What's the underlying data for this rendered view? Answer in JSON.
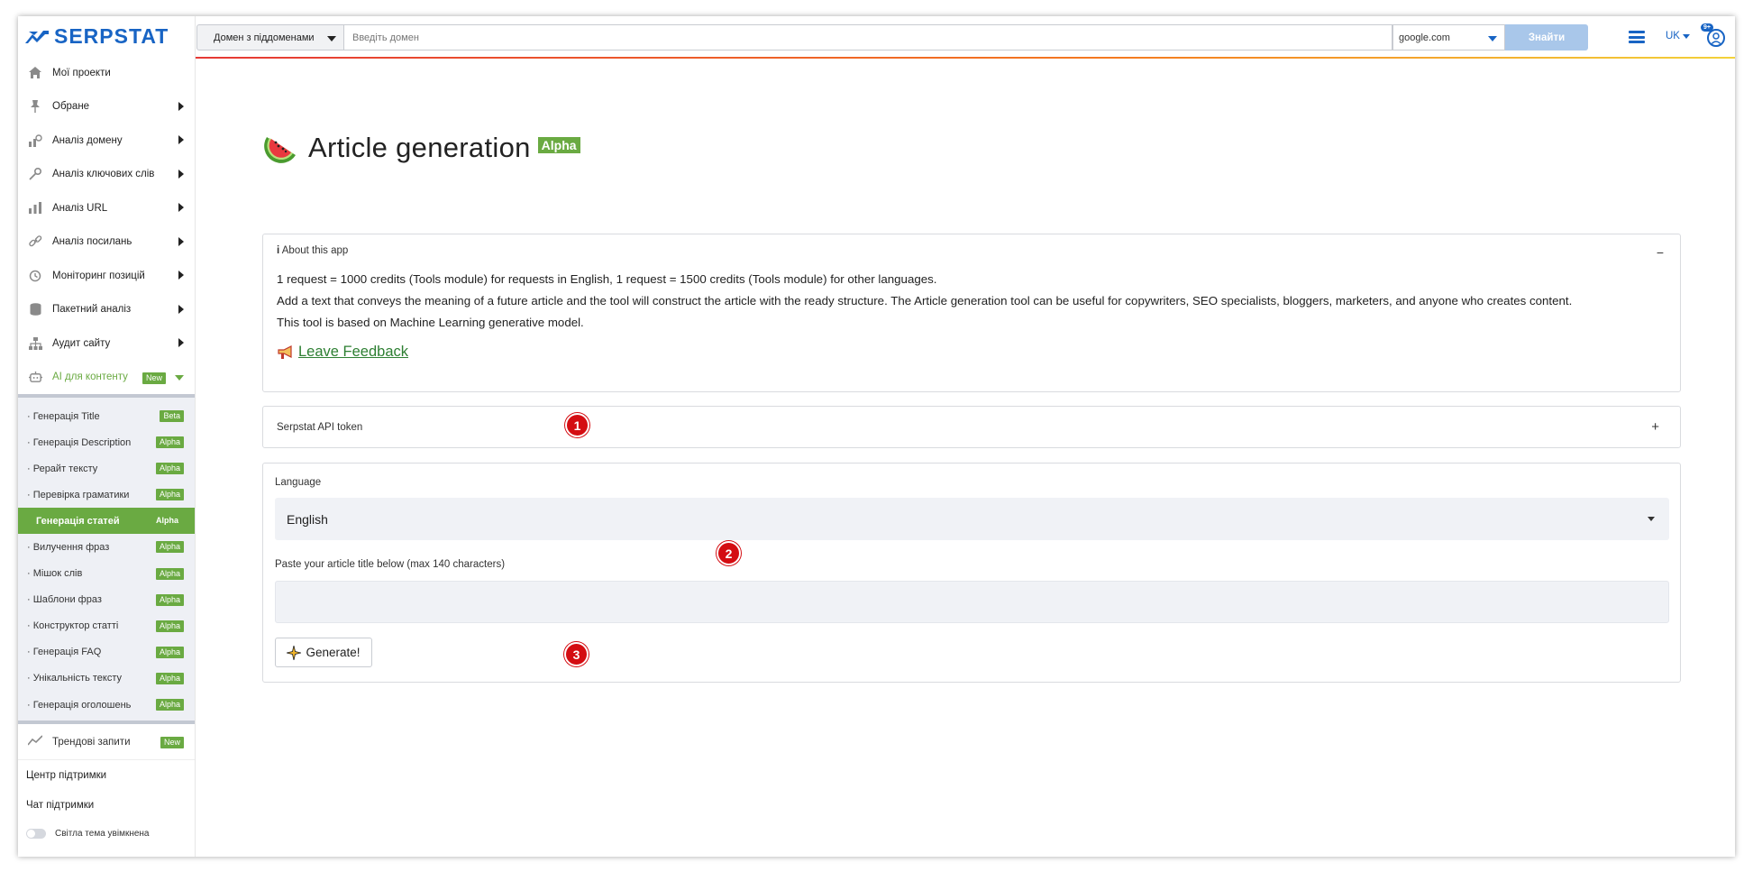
{
  "brand": {
    "name": "SERPSTAT",
    "color": "#1864c4",
    "accent_green": "#6aaa42"
  },
  "sidebar": {
    "items": [
      {
        "label": "Мої проекти",
        "icon": "home-icon",
        "has_arrow": false
      },
      {
        "label": "Обране",
        "icon": "pin-icon",
        "has_arrow": true
      },
      {
        "label": "Аналіз домену",
        "icon": "domain-analysis-icon",
        "has_arrow": true
      },
      {
        "label": "Аналіз ключових слів",
        "icon": "key-icon",
        "has_arrow": true
      },
      {
        "label": "Аналіз URL",
        "icon": "bar-chart-icon",
        "has_arrow": true
      },
      {
        "label": "Аналіз посилань",
        "icon": "link-icon",
        "has_arrow": true
      },
      {
        "label": "Моніторинг позицій",
        "icon": "history-icon",
        "has_arrow": true
      },
      {
        "label": "Пакетний аналіз",
        "icon": "database-icon",
        "has_arrow": true
      },
      {
        "label": "Аудит сайту",
        "icon": "sitemap-icon",
        "has_arrow": true
      }
    ],
    "ai": {
      "label": "AI для контенту",
      "badge": "New",
      "icon": "robot-icon"
    },
    "submenu": [
      {
        "label": "· Генерація Title",
        "badge": "Beta",
        "active": false
      },
      {
        "label": "· Генерація Description",
        "badge": "Alpha",
        "active": false
      },
      {
        "label": "· Рерайт тексту",
        "badge": "Alpha",
        "active": false
      },
      {
        "label": "· Перевірка граматики",
        "badge": "Alpha",
        "active": false
      },
      {
        "label": "Генерація статей",
        "badge": "Alpha",
        "active": true
      },
      {
        "label": "· Вилучення фраз",
        "badge": "Alpha",
        "active": false
      },
      {
        "label": "· Мішок слів",
        "badge": "Alpha",
        "active": false
      },
      {
        "label": "· Шаблони фраз",
        "badge": "Alpha",
        "active": false
      },
      {
        "label": "· Конструктор статті",
        "badge": "Alpha",
        "active": false
      },
      {
        "label": "· Генерація FAQ",
        "badge": "Alpha",
        "active": false
      },
      {
        "label": "· Унікальність тексту",
        "badge": "Alpha",
        "active": false
      },
      {
        "label": "· Генерація оголошень",
        "badge": "Alpha",
        "active": false
      }
    ],
    "trend": {
      "label": "Трендові запити",
      "badge": "New"
    },
    "support_center": "Центр підтримки",
    "support_chat": "Чат підтримки",
    "theme_toggle": "Світла тема увімкнена"
  },
  "topbar": {
    "domain_mode": "Домен з піддоменами",
    "search_placeholder": "Введіть домен",
    "engine": "google.com",
    "find_button": "Знайти",
    "lang": "UK",
    "notifications": "9+"
  },
  "main": {
    "title": "Article generation",
    "title_badge": "Alpha",
    "about": {
      "header": "About this app",
      "info_glyph": "i",
      "collapse": "−",
      "lines": [
        "1 request = 1000 credits (Tools module) for requests in English, 1 request = 1500 credits (Tools module) for other languages.",
        "Add a text that conveys the meaning of a future article and the tool will construct the article with the ready structure. The Article generation tool can be useful for copywriters, SEO specialists, bloggers, marketers, and anyone who creates content.",
        "This tool is based on Machine Learning generative model."
      ],
      "feedback": "Leave Feedback"
    },
    "token": {
      "label": "Serpstat API token",
      "expand": "+"
    },
    "form": {
      "language_label": "Language",
      "language_value": "English",
      "title_label": "Paste your article title below (max 140 characters)",
      "title_value": "",
      "generate_button": "Generate!"
    },
    "markers": [
      "1",
      "2",
      "3"
    ]
  }
}
